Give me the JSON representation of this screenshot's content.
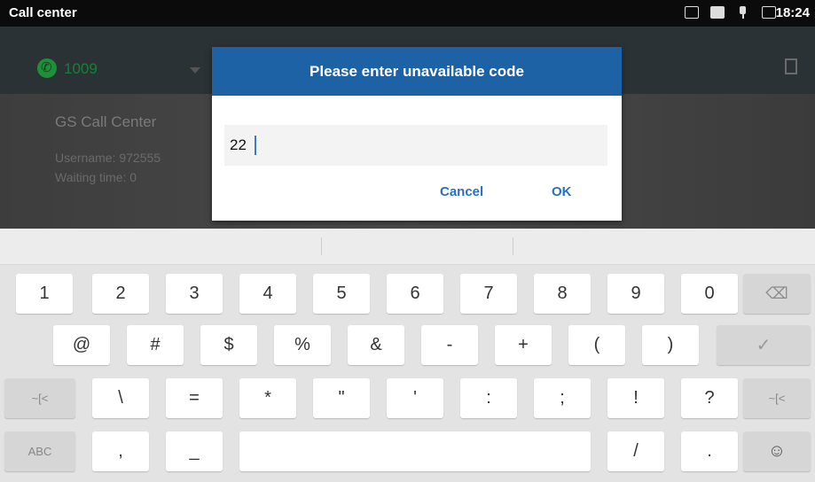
{
  "statusbar": {
    "app_title": "Call center",
    "time": "18:24"
  },
  "background": {
    "account_number": "1009",
    "org_name": "GS Call Center",
    "username_label": "Username: 972555",
    "waiting_label": "Waiting time: 0"
  },
  "dialog": {
    "title": "Please enter unavailable code",
    "input_value": "22",
    "cancel_label": "Cancel",
    "ok_label": "OK"
  },
  "keyboard": {
    "row1": [
      "1",
      "2",
      "3",
      "4",
      "5",
      "6",
      "7",
      "8",
      "9",
      "0"
    ],
    "row2": [
      "@",
      "#",
      "$",
      "%",
      "&",
      "-",
      "+",
      "(",
      ")"
    ],
    "row2_enter": "✓",
    "row3_left": "~[<",
    "row3": [
      "\\",
      "=",
      "*",
      "\"",
      "'",
      ":",
      ";",
      "!",
      "?"
    ],
    "row3_right": "~[<",
    "row4_abc": "ABC",
    "row4_comma": ",",
    "row4_underscore": "_",
    "row4_slash": "/",
    "row4_period": ".",
    "row4_emoji": "☺",
    "backspace": "⌫"
  },
  "colors": {
    "dialog_header": "#1e62a6",
    "button_text": "#2d6fbf",
    "account_green": "#1a7f35"
  }
}
